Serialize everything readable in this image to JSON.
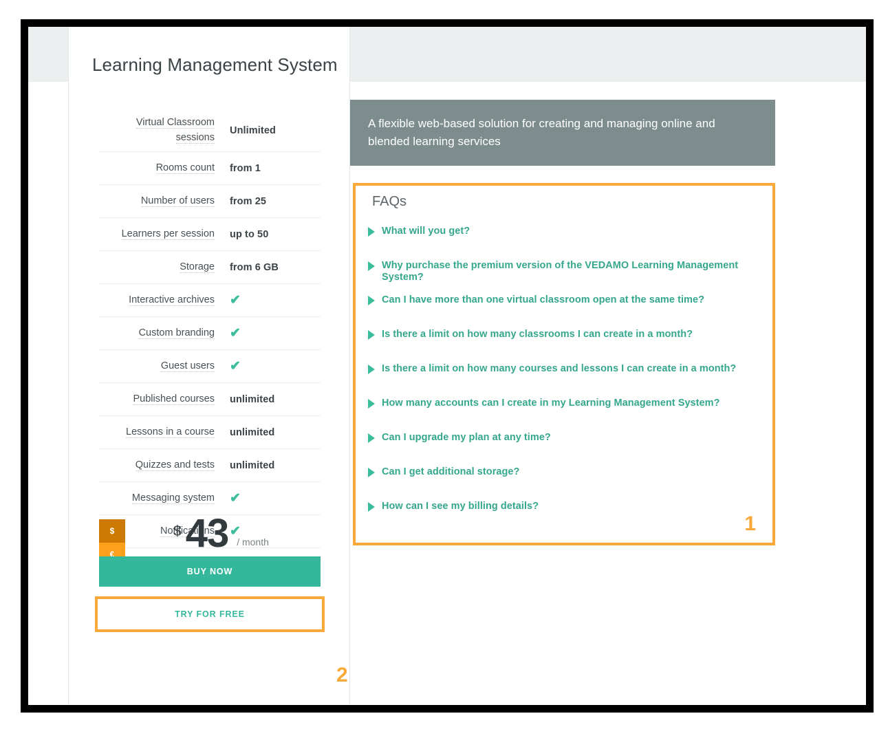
{
  "plan": {
    "title": "Learning Management System",
    "features": [
      {
        "label": "Virtual Classroom sessions",
        "value": "Unlimited",
        "type": "text"
      },
      {
        "label": "Rooms count",
        "value": "from 1",
        "type": "text"
      },
      {
        "label": "Number of users",
        "value": "from 25",
        "type": "text"
      },
      {
        "label": "Learners per session",
        "value": "up to 50",
        "type": "text"
      },
      {
        "label": "Storage",
        "value": "from 6 GB",
        "type": "text"
      },
      {
        "label": "Interactive archives",
        "value": "✔",
        "type": "check"
      },
      {
        "label": "Custom branding",
        "value": "✔",
        "type": "check"
      },
      {
        "label": "Guest users",
        "value": "✔",
        "type": "check"
      },
      {
        "label": "Published courses",
        "value": "unlimited",
        "type": "text"
      },
      {
        "label": "Lessons in a course",
        "value": "unlimited",
        "type": "text"
      },
      {
        "label": "Quizzes and tests",
        "value": "unlimited",
        "type": "text"
      },
      {
        "label": "Messaging system",
        "value": "✔",
        "type": "check"
      },
      {
        "label": "Notifications",
        "value": "✔",
        "type": "check"
      }
    ],
    "pricing": {
      "currency_usd": "$",
      "currency_eur": "€",
      "selected_currency": "$",
      "symbol": "$",
      "amount": "43",
      "period": "/ month"
    },
    "buy_label": "BUY NOW",
    "try_label": "TRY FOR FREE"
  },
  "right": {
    "tagline": "A flexible web-based solution for creating and managing online and blended learning services",
    "faq": {
      "title": "FAQs",
      "items": [
        "What will you get?",
        "Why purchase the premium version of the VEDAMO Learning Management System?",
        "Can I have more than one virtual classroom open at the same time?",
        "Is there a limit on how many classrooms I can create in a month?",
        "Is there a limit on how many courses and lessons I can create in a month?",
        "How many accounts can I create in my Learning Management System?",
        "Can I upgrade my plan at any time?",
        "Can I get additional storage?",
        "How can I see my billing details?"
      ]
    }
  },
  "annotations": {
    "faq_marker": "1",
    "try_marker": "2"
  },
  "colors": {
    "accent_green": "#35b79b",
    "accent_orange": "#f9a939",
    "tagline_grey": "#7d8c8c",
    "header_band": "#eceff0",
    "currency_active": "#cc7a03",
    "currency_inactive": "#ffa01c"
  }
}
